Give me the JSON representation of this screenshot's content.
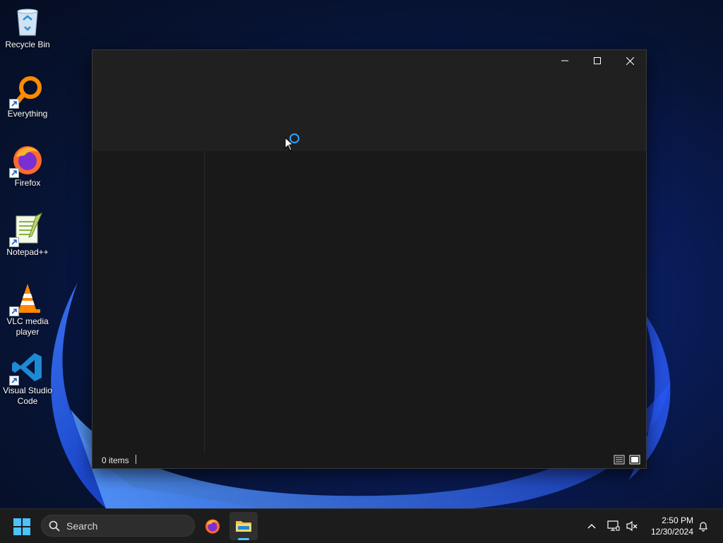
{
  "desktop": {
    "icons": [
      {
        "label": "Recycle Bin",
        "icon": "recycle-bin-icon"
      },
      {
        "label": "Everything",
        "icon": "everything-search-icon"
      },
      {
        "label": "Firefox",
        "icon": "firefox-icon"
      },
      {
        "label": "Notepad++",
        "icon": "notepad-plus-plus-icon"
      },
      {
        "label": "VLC media player",
        "icon": "vlc-cone-icon"
      },
      {
        "label": "Visual Studio Code",
        "icon": "vscode-icon"
      }
    ]
  },
  "window": {
    "title": "",
    "status": {
      "item_count": "0 items"
    },
    "controls": [
      "minimize-icon",
      "maximize-icon",
      "close-icon"
    ]
  },
  "taskbar": {
    "search_label": "Search",
    "apps": [
      "firefox-icon",
      "file-explorer-icon"
    ],
    "clock": {
      "time": "2:50 PM",
      "date": "12/30/2024"
    }
  },
  "colors": {
    "accent": "#4cc2ff",
    "window_bg": "#191919",
    "titlebar_bg": "#202020",
    "taskbar_bg": "#1c1c1c"
  }
}
